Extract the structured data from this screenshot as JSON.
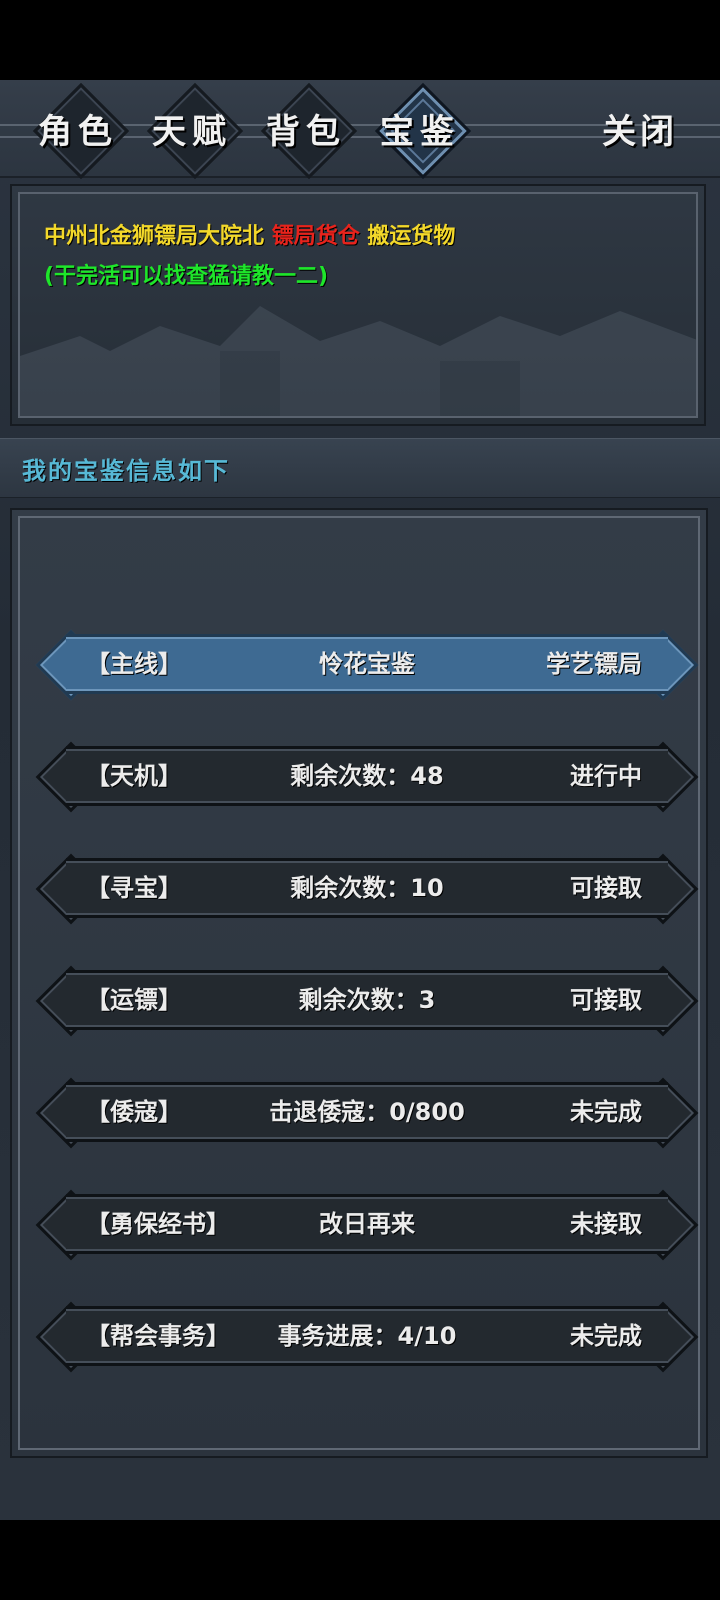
{
  "tabs": [
    {
      "label": "角色",
      "active": false
    },
    {
      "label": "天赋",
      "active": false
    },
    {
      "label": "背包",
      "active": false
    },
    {
      "label": "宝鉴",
      "active": true
    }
  ],
  "close_label": "关闭",
  "info": {
    "task_line1_a": "中州北金狮镖局大院北",
    "task_line1_b": "镖局货仓",
    "task_line1_c": "搬运货物",
    "task_line2": "(干完活可以找查猛请教一二)",
    "colors": {
      "yellow": "#f3d82a",
      "red": "#e8231c",
      "green": "#1ee62a"
    }
  },
  "section_title": "我的宝鉴信息如下",
  "rows": [
    {
      "tag": "【主线】",
      "detail": "怜花宝鉴",
      "status": "学艺镖局",
      "highlight": true
    },
    {
      "tag": "【天机】",
      "detail": "剩余次数：48",
      "status": "进行中",
      "highlight": false
    },
    {
      "tag": "【寻宝】",
      "detail": "剩余次数：10",
      "status": "可接取",
      "highlight": false
    },
    {
      "tag": "【运镖】",
      "detail": "剩余次数：3",
      "status": "可接取",
      "highlight": false
    },
    {
      "tag": "【倭寇】",
      "detail": "击退倭寇：0/800",
      "status": "未完成",
      "highlight": false
    },
    {
      "tag": "【勇保经书】",
      "detail": "改日再来",
      "status": "未接取",
      "highlight": false
    },
    {
      "tag": "【帮会事务】",
      "detail": "事务进展：4/10",
      "status": "未完成",
      "highlight": false
    }
  ]
}
